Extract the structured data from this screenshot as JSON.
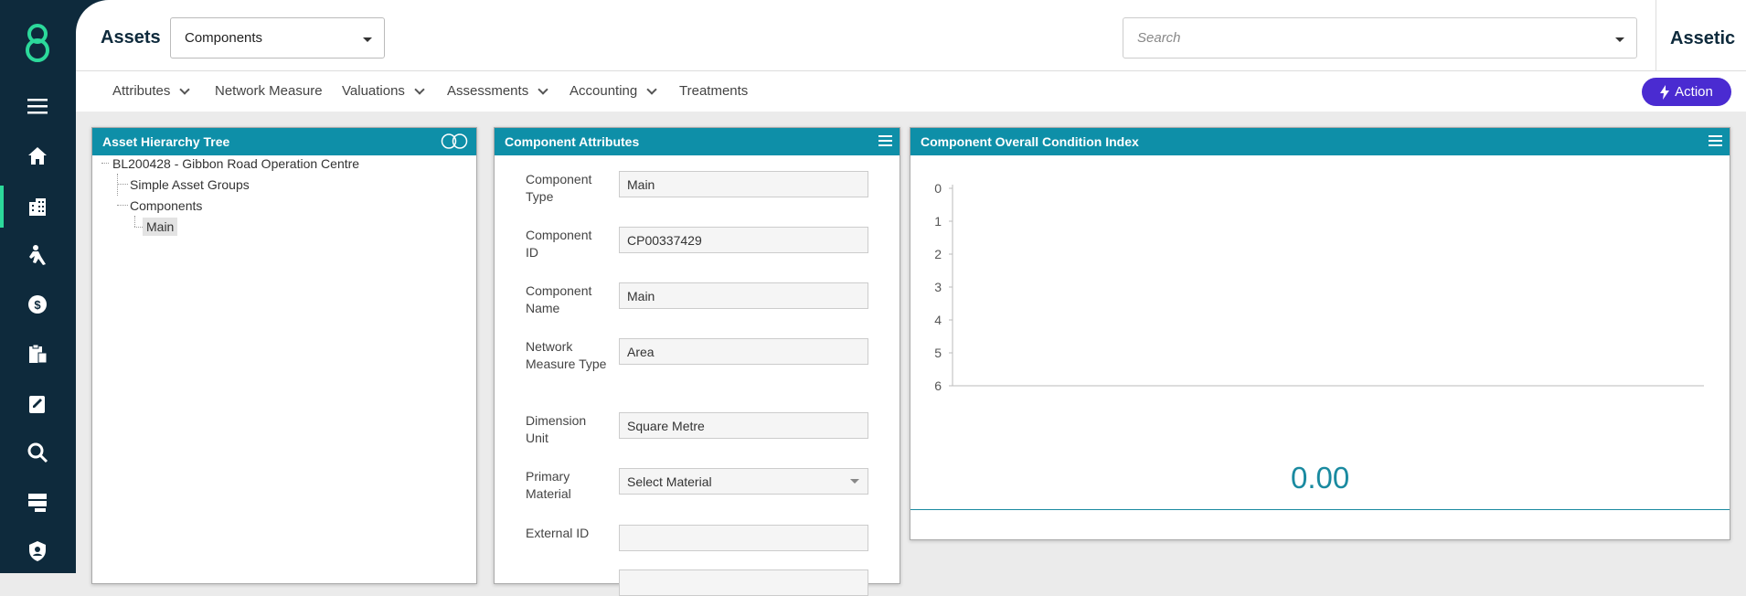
{
  "app": {
    "page_title": "Assets",
    "module_select": "Components",
    "search_placeholder": "Search",
    "brand": "Assetic"
  },
  "sidebar": {
    "icons": [
      "menu-icon",
      "home-icon",
      "building-icon",
      "worker-icon",
      "dollar-icon",
      "clipboard-icon",
      "edit-task-icon",
      "search-icon",
      "server-icon",
      "shield-icon"
    ]
  },
  "menu": {
    "items": [
      {
        "label": "Attributes",
        "dropdown": true
      },
      {
        "label": "Network Measure",
        "dropdown": false
      },
      {
        "label": "Valuations",
        "dropdown": true
      },
      {
        "label": "Assessments",
        "dropdown": true
      },
      {
        "label": "Accounting",
        "dropdown": true
      },
      {
        "label": "Treatments",
        "dropdown": false
      }
    ],
    "action_label": "Action"
  },
  "tree_panel": {
    "title": "Asset Hierarchy Tree",
    "nodes": [
      {
        "label": "BL200428 - Gibbon Road Operation Centre"
      },
      {
        "label": "Simple Asset Groups"
      },
      {
        "label": "Components"
      },
      {
        "label": "Main"
      }
    ]
  },
  "attributes_panel": {
    "title": "Component Attributes",
    "rows": [
      {
        "label": "Component Type",
        "value": "Main"
      },
      {
        "label": "Component ID",
        "value": "CP00337429"
      },
      {
        "label": "Component Name",
        "value": "Main"
      },
      {
        "label": "Network Measure Type",
        "value": "Area"
      },
      {
        "label": "Dimension Unit",
        "value": "Square Metre"
      },
      {
        "label": "Primary Material",
        "value": "Select Material"
      },
      {
        "label": "External ID",
        "value": ""
      }
    ]
  },
  "condition_panel": {
    "title": "Component Overall Condition Index",
    "value": "0.00"
  },
  "chart_data": {
    "type": "line",
    "title": "",
    "xlabel": "",
    "ylabel": "",
    "y_ticks": [
      "0",
      "1",
      "2",
      "3",
      "4",
      "5",
      "6"
    ],
    "ylim": [
      0,
      6
    ],
    "series": []
  },
  "colors": {
    "sidebar": "#0e2a3c",
    "accent_teal": "#0e8fa8",
    "action_purple": "#4a2bd1",
    "active_green": "#2cd99b"
  }
}
